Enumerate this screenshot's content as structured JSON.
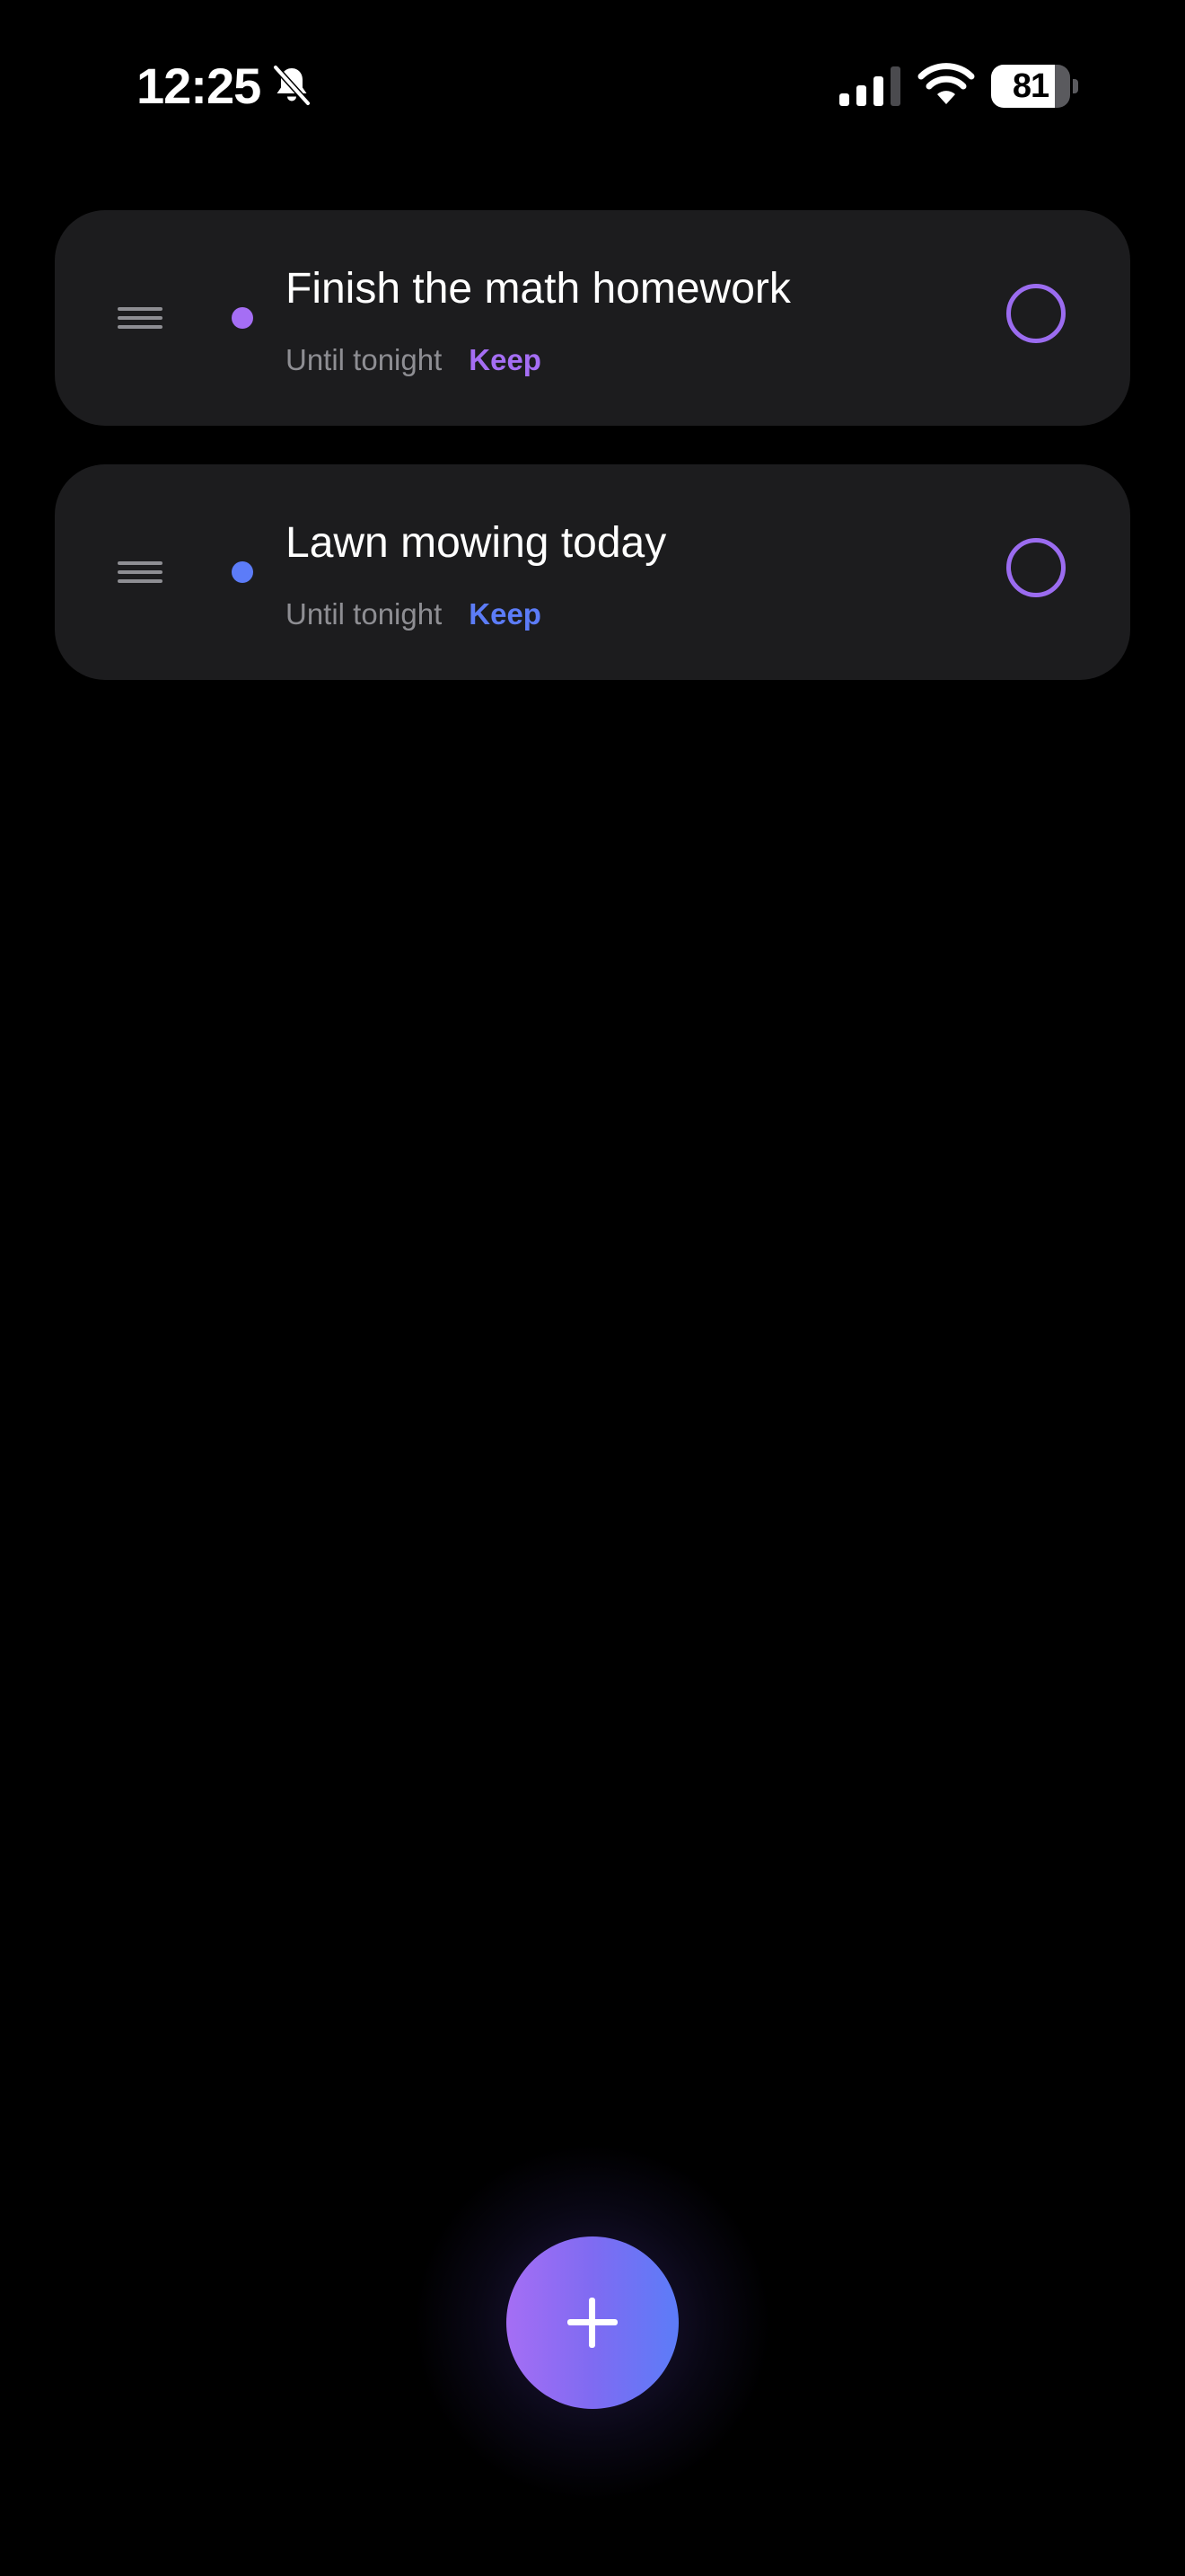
{
  "status_bar": {
    "time": "12:25",
    "silent_icon": "bell-slash-icon",
    "cellular_icon": "cellular-signal-icon",
    "wifi_icon": "wifi-icon",
    "battery_icon": "battery-icon",
    "battery_level": "81",
    "battery_percent": 81
  },
  "tasks": [
    {
      "title": "Finish the math homework",
      "due": "Until tonight",
      "action_label": "Keep",
      "dot_color": "#a56ef4",
      "action_color": "#a56ef4"
    },
    {
      "title": "Lawn mowing today",
      "due": "Until tonight",
      "action_label": "Keep",
      "dot_color": "#5c7cf8",
      "action_color": "#5c7cf8"
    }
  ],
  "fab": {
    "icon": "plus-icon",
    "gradient_start": "#a56ef4",
    "gradient_end": "#5c7cf8"
  },
  "colors": {
    "background": "#000000",
    "card": "#1c1c1e",
    "secondary_text": "#8e8e93",
    "check_circle": "#9b6cf0"
  }
}
